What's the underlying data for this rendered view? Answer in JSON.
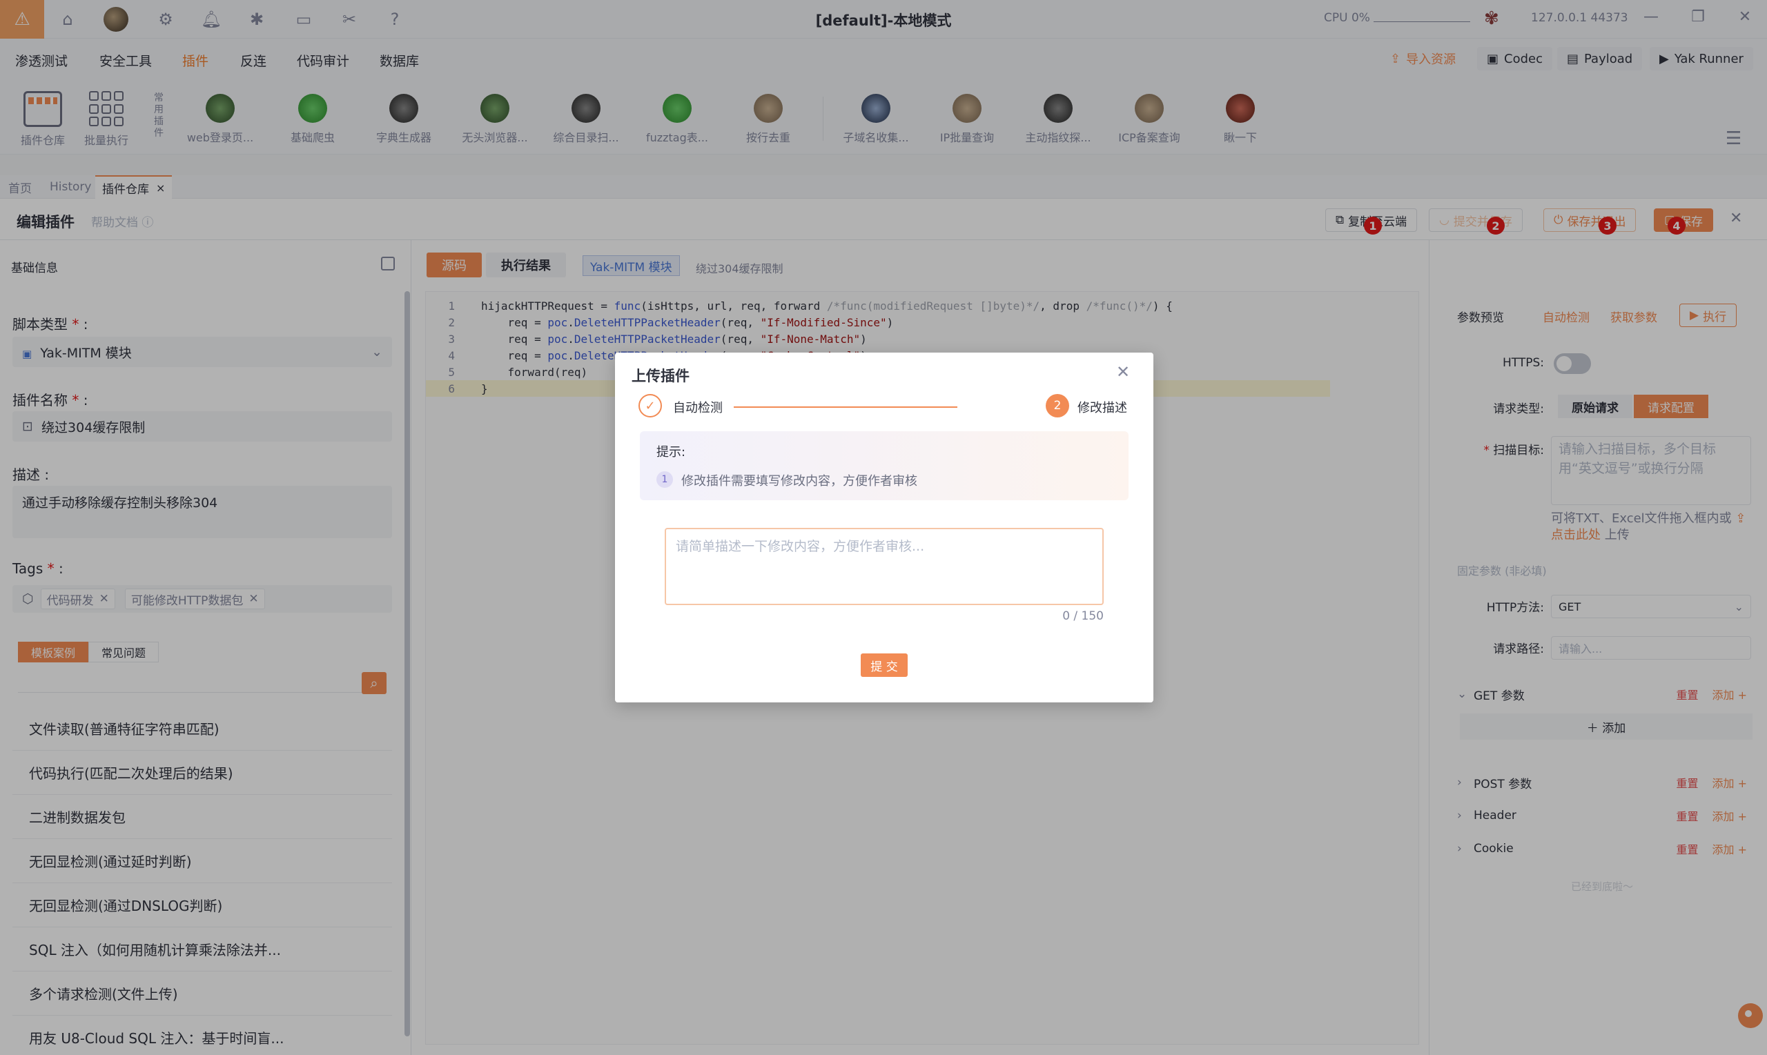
{
  "titlebar": {
    "title": "[default]-本地模式",
    "cpu_label": "CPU 0%",
    "ip": "127.0.0.1 44373"
  },
  "menu": {
    "items": [
      "渗透测试",
      "安全工具",
      "插件",
      "反连",
      "代码审计",
      "数据库"
    ],
    "active_index": 2,
    "right": {
      "import": "导入资源",
      "codec": "Codec",
      "payload": "Payload",
      "runner": "Yak Runner"
    }
  },
  "plugin_toolbar": {
    "store_label": "插件仓库",
    "batch_label": "批量执行",
    "side_label": "常用插件",
    "items": [
      "web登录页...",
      "基础爬虫",
      "字典生成器",
      "无头浏览器...",
      "综合目录扫...",
      "fuzztag表...",
      "按行去重",
      "子域名收集...",
      "IP批量查询",
      "主动指纹探...",
      "ICP备案查询",
      "瞅一下"
    ]
  },
  "tabs": {
    "items": [
      "首页",
      "History",
      "插件仓库"
    ],
    "close": "×"
  },
  "editor_header": {
    "title": "编辑插件",
    "help": "帮助文档",
    "buttons": {
      "copy": "复制至云端",
      "submit_save": "提交并保存",
      "save_exit": "保存并退出",
      "save": "保存"
    },
    "badges": [
      "1",
      "2",
      "3",
      "4"
    ]
  },
  "left_panel": {
    "section_title": "基础信息",
    "script_type_label": "脚本类型",
    "script_type_value": "Yak-MITM 模块",
    "name_label": "插件名称",
    "name_value": "绕过304缓存限制",
    "desc_label": "描述",
    "desc_value": "通过手动移除缓存控制头移除304",
    "tags_label": "Tags",
    "tags": [
      "代码研发",
      "可能修改HTTP数据包"
    ],
    "subtabs": [
      "模板案例",
      "常见问题"
    ],
    "list": [
      "文件读取(普通特征字符串匹配)",
      "代码执行(匹配二次处理后的结果)",
      "二进制数据发包",
      "无回显检测(通过延时判断)",
      "无回显检测(通过DNSLOG判断)",
      "SQL 注入（如何用随机计算乘法除法并...",
      "多个请求检测(文件上传)",
      "用友 U8-Cloud SQL 注入：基于时间盲..."
    ]
  },
  "center": {
    "tab_source": "源码",
    "tab_result": "执行结果",
    "type_tag": "Yak-MITM 模块",
    "plugin_name": "绕过304缓存限制",
    "line_numbers": [
      "1",
      "2",
      "3",
      "4",
      "5",
      "6"
    ]
  },
  "right_panel": {
    "preview": "参数预览",
    "auto_detect": "自动检测",
    "get_params": "获取参数",
    "execute": "执行",
    "https_label": "HTTPS:",
    "req_type_label": "请求类型:",
    "req_raw": "原始请求",
    "req_config": "请求配置",
    "target_label": "扫描目标:",
    "target_placeholder": "请输入扫描目标，多个目标用“英文逗号”或换行分隔",
    "upload_hint_a": "可将TXT、Excel文件拖入框内或",
    "upload_link": "点击此处",
    "upload_hint_b": "上传",
    "fixed_params": "固定参数 (非必填)",
    "method_label": "HTTP方法:",
    "method_value": "GET",
    "path_label": "请求路径:",
    "path_placeholder": "请输入...",
    "sections": [
      "GET 参数",
      "POST 参数",
      "Header",
      "Cookie"
    ],
    "reset": "重置",
    "add": "添加",
    "add_row": "添加",
    "end_text": "已经到底啦～"
  },
  "modal": {
    "title": "上传插件",
    "step1": "自动检测",
    "step2": "修改描述",
    "step2_num": "2",
    "tip_title": "提示:",
    "tip_num": "1",
    "tip_text": "修改插件需要填写修改内容，方便作者审核",
    "textarea_placeholder": "请简单描述一下修改内容，方便作者审核...",
    "count": "0 / 150",
    "submit": "提 交"
  }
}
